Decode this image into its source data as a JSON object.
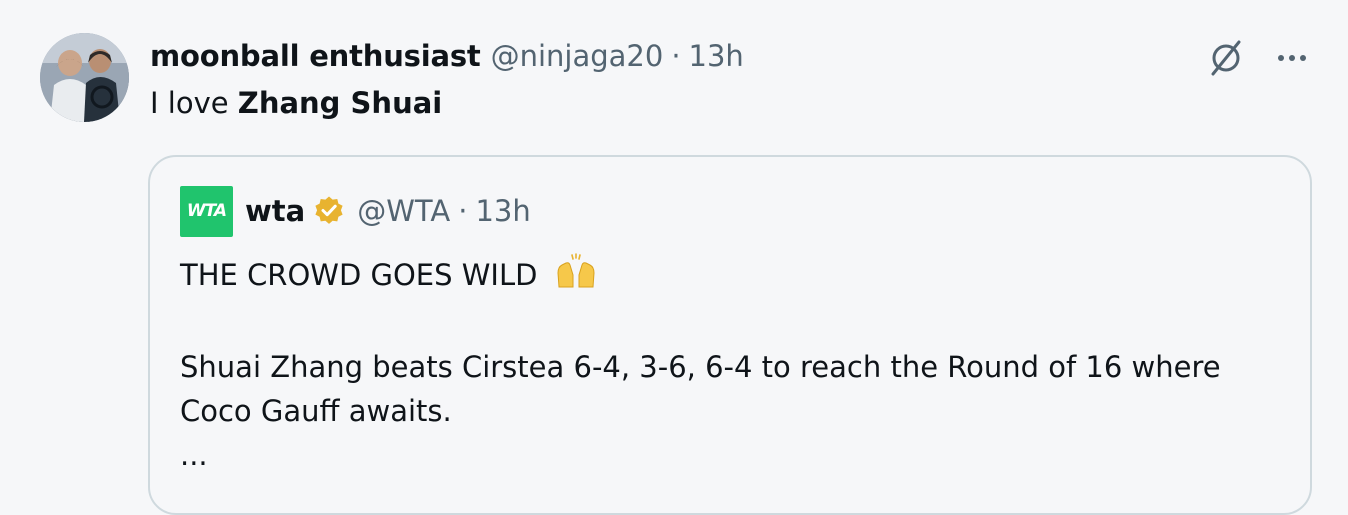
{
  "tweet": {
    "display_name": "moonball enthusiast",
    "handle": "@ninjaga20",
    "separator": "·",
    "time": "13h",
    "text_prefix": "I love ",
    "text_bold": "Zhang Shuai"
  },
  "icons": {
    "grok": "slashed-circle-icon",
    "more": "more-icon",
    "more_glyph": "···"
  },
  "quote": {
    "logo_text": "WTA",
    "display_name": "wta",
    "verified": "gold-verified-badge",
    "handle": "@WTA",
    "separator": "·",
    "time": "13h",
    "line1": "THE CROWD GOES WILD",
    "line1_emoji": "raised-hands-icon",
    "line2": "Shuai Zhang beats Cirstea 6-4, 3-6, 6-4 to reach the Round of 16 where",
    "line3": "Coco Gauff awaits.",
    "line4": "..."
  },
  "colors": {
    "background": "#f6f7f9",
    "text": "#0f1419",
    "secondary": "#536471",
    "border": "#cfd9de",
    "wta_green": "#20c46d",
    "verified_gold": "#e8b330"
  }
}
